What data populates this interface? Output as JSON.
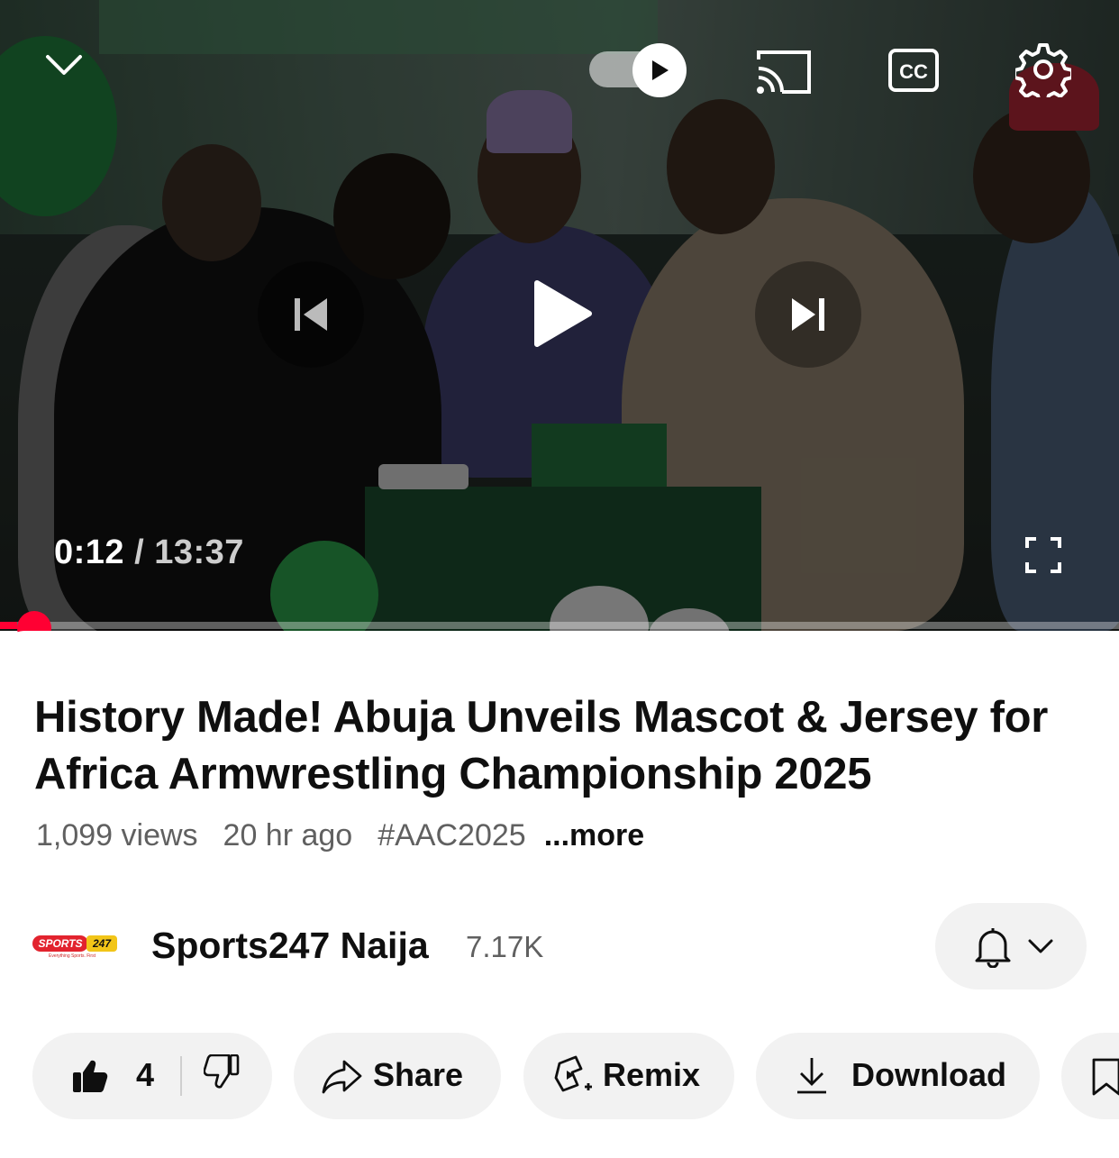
{
  "player": {
    "current_time": "0:12",
    "duration": "/ 13:37",
    "progress_fraction": 0.015,
    "autoplay_on": true,
    "icons": {
      "collapse": "chevron-down-icon",
      "autoplay": "autoplay-toggle-icon",
      "cast": "cast-icon",
      "captions": "closed-captions-icon",
      "settings": "gear-icon",
      "previous": "skip-previous-icon",
      "play": "play-icon",
      "next": "skip-next-icon",
      "fullscreen": "fullscreen-icon"
    },
    "captions_label": "CC"
  },
  "video": {
    "title": "History Made! Abuja Unveils Mascot & Jersey for Africa Armwrestling Championship 2025",
    "views": "1,099 views",
    "age": "20 hr ago",
    "hashtag": "#AAC2025",
    "more": "...more"
  },
  "channel": {
    "logo_text_red": "SPORTS",
    "logo_text_yellow": "247",
    "logo_tagline": "Everything Sports. First",
    "name": "Sports247 Naija",
    "subscribers": "7.17K",
    "notif_icon": "bell-icon"
  },
  "actions": {
    "likes": "4",
    "share": "Share",
    "remix": "Remix",
    "download": "Download"
  },
  "colors": {
    "accent": "#ff0033",
    "pill_bg": "#f2f2f2",
    "secondary_text": "#606060"
  }
}
